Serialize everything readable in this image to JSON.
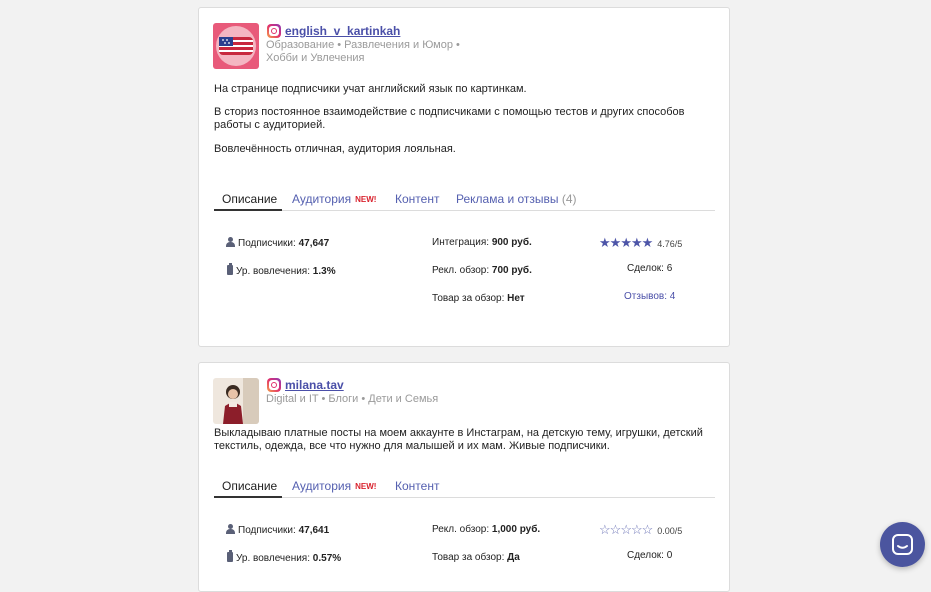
{
  "listings": [
    {
      "handle": "english_v_kartinkah",
      "categories": "Образование • Развлечения и Юмор • Хобби и Увлечения",
      "description": [
        "На странице подписчики учат английский язык по картинкам.",
        "В сториз постоянное взаимодействие с подписчиками с помощью тестов и других способов работы с аудиторией.",
        "Вовлечённость отличная, аудитория лояльная."
      ],
      "tabs": {
        "description": "Описание",
        "audience": "Аудитория",
        "new_badge": "NEW!",
        "content": "Контент",
        "reviews": "Реклама и отзывы",
        "reviews_count": "(4)"
      },
      "stats": {
        "followers_label": "Подписчики:",
        "followers": "47,647",
        "engagement_label": "Ур. вовлечения:",
        "engagement": "1.3%",
        "integration_label": "Интеграция:",
        "integration": "900 руб.",
        "review_label": "Рекл. обзор:",
        "review": "700 руб.",
        "product_label": "Товар за обзор:",
        "product": "Нет",
        "rating": 4.76,
        "rating_text": "4.76/5",
        "deals": "Сделок: 6",
        "reviews_link": "Отзывов: 4"
      }
    },
    {
      "handle": "milana.tav",
      "categories": "Digital и IT • Блоги • Дети и Семья",
      "description": [
        "Выкладываю платные посты на моем аккаунте в Инстаграм, на детскую тему, игрушки, детский текстиль, одежда, все что нужно для малышей и их мам. Живые подписчики."
      ],
      "tabs": {
        "description": "Описание",
        "audience": "Аудитория",
        "new_badge": "NEW!",
        "content": "Контент"
      },
      "stats": {
        "followers_label": "Подписчики:",
        "followers": "47,641",
        "engagement_label": "Ур. вовлечения:",
        "engagement": "0.57%",
        "review_label": "Рекл. обзор:",
        "review": "1,000 руб.",
        "product_label": "Товар за обзор:",
        "product": "Да",
        "rating": 0,
        "rating_text": "0.00/5",
        "deals": "Сделок: 0"
      }
    }
  ],
  "icons": {
    "instagram": "instagram-icon",
    "followers": "person-icon",
    "engagement": "battery-icon",
    "chat": "chat-icon"
  },
  "colors": {
    "link": "#4a4fa8",
    "badge": "#d9232e",
    "chat_button": "#4b559f",
    "star": "#4d55a8"
  }
}
